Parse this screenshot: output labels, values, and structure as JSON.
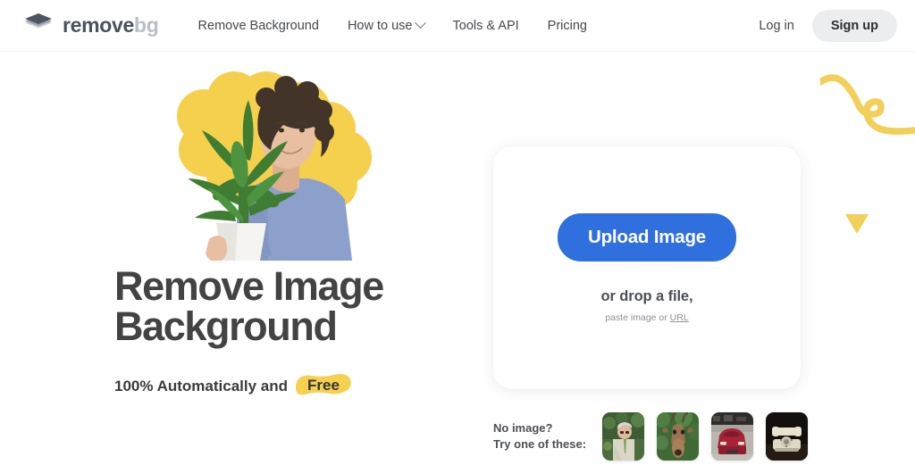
{
  "header": {
    "logo": {
      "icon": "layers-diamond-icon",
      "text_primary": "remove",
      "text_secondary": "bg"
    },
    "nav_items": [
      {
        "label": "Remove Background",
        "has_dropdown": false
      },
      {
        "label": "How to use",
        "has_dropdown": true
      },
      {
        "label": "Tools & API",
        "has_dropdown": false
      },
      {
        "label": "Pricing",
        "has_dropdown": false
      }
    ],
    "login_label": "Log in",
    "signup_label": "Sign up",
    "signup_bg": "#ecedef"
  },
  "hero": {
    "headline_line1": "Remove Image",
    "headline_line2": "Background",
    "subline_prefix": "100% Automatically and",
    "subline_highlight": "Free",
    "highlight_color": "#f6d14f",
    "headline_color": "#434343",
    "art": {
      "name": "man-holding-potted-plant-photo",
      "blob_color": "#f5d04d",
      "shirt_color": "#8da0cc",
      "plant_color": "#3f7d33",
      "skin_color": "#e8bfa0",
      "hair_color": "#43342a",
      "pot_color": "#f3f2ee"
    }
  },
  "upload": {
    "button_label": "Upload Image",
    "button_color": "#3070de",
    "drop_text": "or drop a file,",
    "paste_prefix": "paste image or ",
    "paste_link": "URL"
  },
  "samples": {
    "label_line1": "No image?",
    "label_line2": "Try one of these:",
    "thumbnails": [
      {
        "name": "sample-thumb-man-portrait",
        "alt": "Man with glasses in garden"
      },
      {
        "name": "sample-thumb-antelope",
        "alt": "Antelope in green foliage"
      },
      {
        "name": "sample-thumb-red-car",
        "alt": "Red sports car front view"
      },
      {
        "name": "sample-thumb-vintage-phone",
        "alt": "Vintage rotary telephone on dark background"
      }
    ]
  },
  "decor": {
    "squiggle_color": "#f2cf58",
    "triangle_color": "#f2cf58"
  }
}
